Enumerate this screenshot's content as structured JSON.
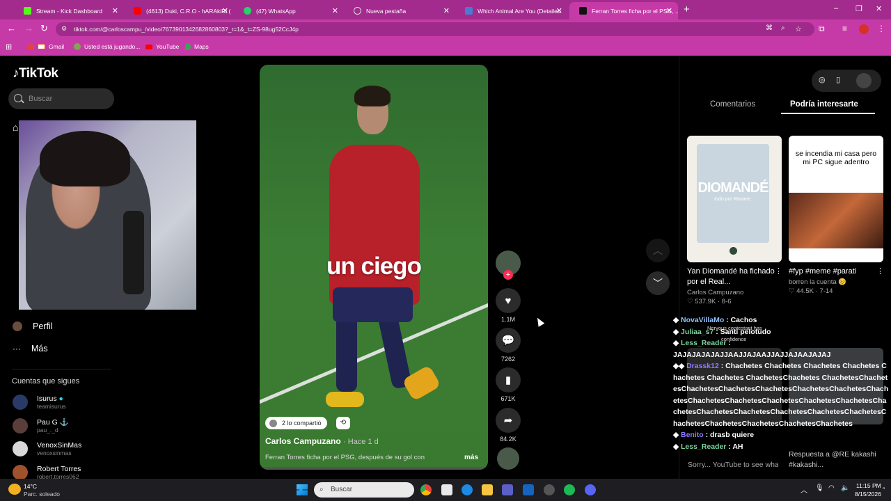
{
  "browser": {
    "tabs": [
      {
        "title": "Stream - Kick Dashboard",
        "color": "#53fc18"
      },
      {
        "title": "(4613) Duki, C.R.O - hARAkiRi (",
        "color": "#ff0000"
      },
      {
        "title": "(47) WhatsApp",
        "color": "#25d366"
      },
      {
        "title": "Nueva pestaña",
        "color": "#dddddd"
      },
      {
        "title": "Which Animal Are You (Detailed",
        "color": "#4a7bd0"
      },
      {
        "title": "Ferran Torres ficha por el PSG, ...",
        "color": "#111111"
      }
    ],
    "new_tab": "+",
    "url": "tiktok.com/@carloscampu_/video/7673901342682860803?_r=1&_t=ZS-98ug52CcJ4p",
    "bookmarks": [
      "Gmail",
      "Usted está jugando...",
      "YouTube",
      "Maps"
    ],
    "window_controls": [
      "–",
      "❐",
      "✕"
    ]
  },
  "tiktok": {
    "logo": "TikTok",
    "search_placeholder": "Buscar",
    "nav": [
      {
        "label": "Perfil",
        "icon": "profile-icon"
      },
      {
        "label": "Más",
        "icon": "more-icon"
      }
    ],
    "following_title": "Cuentas que sigues",
    "following": [
      {
        "name": "Isurus",
        "handle": "teamisurus",
        "verified": true
      },
      {
        "name": "Pau G",
        "handle": "pau_._d"
      },
      {
        "name": "VenoxSinMas",
        "handle": "venoxsinmas"
      },
      {
        "name": "Robert Torres",
        "handle": "robert.torres062"
      }
    ],
    "video": {
      "overlay_text": "un ciego",
      "shared_label": "2 lo compartió",
      "author": "Carlos Campuzano",
      "time": "· Hace 1 d",
      "description": "Ferran Torres ficha por el PSG, después de su gol con",
      "more": "más"
    },
    "actions": {
      "likes": "1.1M",
      "comments": "7262",
      "saves": "671K",
      "shares": "84.2K"
    },
    "right_panel": {
      "tab_comments": "Comentarios",
      "tab_suggested": "Podría interesarte",
      "cards": [
        {
          "thumb_text": "DIOMANDÉ",
          "thumb_sub": "todo por Roxane.",
          "title": "Yan Diomandé ha fichado por el Real...",
          "author": "Carlos Campuzano",
          "likes": "537.9K",
          "date": "8-6"
        },
        {
          "thumb_text": "se incendia mi casa pero mi PC sigue adentro",
          "title": "#fyp #meme #parati",
          "author": "borren la cuenta 🥺",
          "likes": "44.5K",
          "date": "7-14"
        }
      ],
      "bottom_cards": [
        {
          "title": "Sorry... YouTube to see what happened li..."
        },
        {
          "title": "Respuesta a @RE kakashi #kakashi..."
        }
      ]
    },
    "stream_overlay": {
      "meme_text_1": "Nervous contestant has",
      "meme_text_2": "confidence",
      "chat": [
        {
          "user": "NovaVillaMo",
          "msg": "Cachos"
        },
        {
          "user": "Juliaa_s7",
          "msg": "Santi pelotudo"
        },
        {
          "user": "Less_Reader",
          "msg": "JAJAJAJAJAJJAAJJAJAAJJAJJAJAAJAJAJ"
        },
        {
          "user": "Drassk12",
          "msg": "Chachetes Chachetes Chachetes Chachetes Chachetes Chachetes ChachetesChachetes ChachetesChachetesChachetesChachetesChachetesChachetesChachetesChachetesChachetesChachetesChachetesChachetesChachetesChachetesChachetesChachetesChachetesChachetesChachetesChachetesChachetesChachetesChachetesChachetes"
        },
        {
          "user": "Benito",
          "msg": "drasb quiere"
        },
        {
          "user": "Less_Reader",
          "msg": "AH"
        }
      ]
    }
  },
  "taskbar": {
    "weather_temp": "14°C",
    "weather_desc": "Parc. soleado",
    "search": "Buscar",
    "time": "11:15 PM",
    "date": "8/15/2026"
  }
}
